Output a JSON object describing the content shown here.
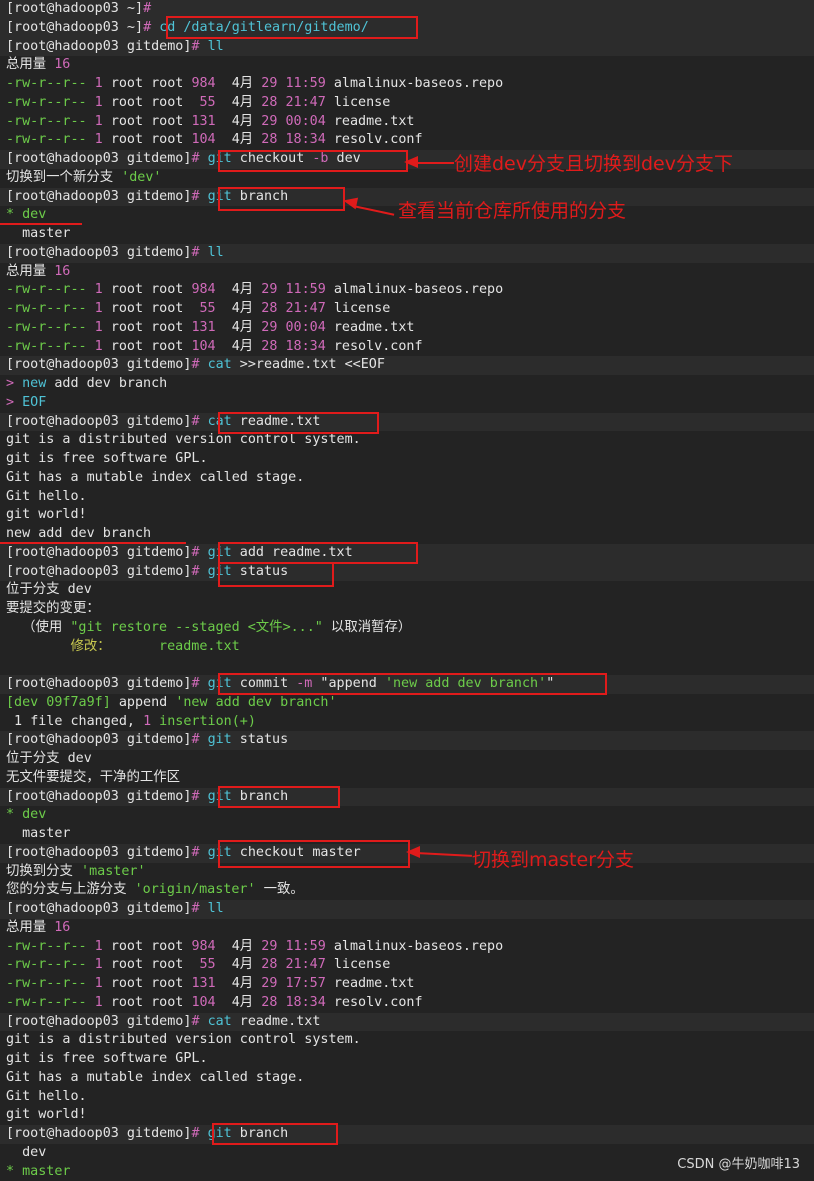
{
  "lines": [
    {
      "pl": 1,
      "segs": [
        [
          "[root@hadoop03 ~]",
          "wt"
        ],
        [
          "#",
          "pr"
        ]
      ]
    },
    {
      "pl": 1,
      "segs": [
        [
          "[root@hadoop03 ~]",
          "wt"
        ],
        [
          "# ",
          "pr"
        ],
        [
          "cd /data/gitlearn/gitdemo/",
          "cy"
        ]
      ]
    },
    {
      "pl": 1,
      "segs": [
        [
          "[root@hadoop03 gitdemo]",
          "wt"
        ],
        [
          "# ",
          "pr"
        ],
        [
          "ll",
          "cy"
        ]
      ]
    },
    {
      "segs": [
        [
          "总用量 ",
          "wt"
        ],
        [
          "16",
          "nm"
        ]
      ]
    },
    {
      "segs": [
        [
          "-rw-r--r--",
          "g"
        ],
        [
          " 1 ",
          "nm"
        ],
        [
          "root root ",
          "wt"
        ],
        [
          "984",
          "nm"
        ],
        [
          "  4月 ",
          "wt"
        ],
        [
          "29 11:59",
          "nm"
        ],
        [
          " almalinux-baseos.repo",
          "wt"
        ]
      ]
    },
    {
      "segs": [
        [
          "-rw-r--r--",
          "g"
        ],
        [
          " 1 ",
          "nm"
        ],
        [
          "root root  ",
          "wt"
        ],
        [
          "55",
          "nm"
        ],
        [
          "  4月 ",
          "wt"
        ],
        [
          "28 21:47",
          "nm"
        ],
        [
          " license",
          "wt"
        ]
      ]
    },
    {
      "segs": [
        [
          "-rw-r--r--",
          "g"
        ],
        [
          " 1 ",
          "nm"
        ],
        [
          "root root ",
          "wt"
        ],
        [
          "131",
          "nm"
        ],
        [
          "  4月 ",
          "wt"
        ],
        [
          "29 00:04",
          "nm"
        ],
        [
          " readme.txt",
          "wt"
        ]
      ]
    },
    {
      "segs": [
        [
          "-rw-r--r--",
          "g"
        ],
        [
          " 1 ",
          "nm"
        ],
        [
          "root root ",
          "wt"
        ],
        [
          "104",
          "nm"
        ],
        [
          "  4月 ",
          "wt"
        ],
        [
          "28 18:34",
          "nm"
        ],
        [
          " resolv.conf",
          "wt"
        ]
      ]
    },
    {
      "pl": 1,
      "segs": [
        [
          "[root@hadoop03 gitdemo]",
          "wt"
        ],
        [
          "# ",
          "pr"
        ],
        [
          "git",
          "cy"
        ],
        [
          " checkout ",
          "wt"
        ],
        [
          "-b",
          "nm"
        ],
        [
          " dev",
          "wt"
        ]
      ]
    },
    {
      "segs": [
        [
          "切换到一个新分支 ",
          "wt"
        ],
        [
          "'dev'",
          "str"
        ]
      ]
    },
    {
      "pl": 1,
      "segs": [
        [
          "[root@hadoop03 gitdemo]",
          "wt"
        ],
        [
          "# ",
          "pr"
        ],
        [
          "git",
          "cy"
        ],
        [
          " branch",
          "wt"
        ]
      ]
    },
    {
      "segs": [
        [
          "* dev",
          "g"
        ]
      ]
    },
    {
      "segs": [
        [
          "  master",
          "wt"
        ]
      ]
    },
    {
      "pl": 1,
      "segs": [
        [
          "[root@hadoop03 gitdemo]",
          "wt"
        ],
        [
          "# ",
          "pr"
        ],
        [
          "ll",
          "cy"
        ]
      ]
    },
    {
      "segs": [
        [
          "总用量 ",
          "wt"
        ],
        [
          "16",
          "nm"
        ]
      ]
    },
    {
      "segs": [
        [
          "-rw-r--r--",
          "g"
        ],
        [
          " 1 ",
          "nm"
        ],
        [
          "root root ",
          "wt"
        ],
        [
          "984",
          "nm"
        ],
        [
          "  4月 ",
          "wt"
        ],
        [
          "29 11:59",
          "nm"
        ],
        [
          " almalinux-baseos.repo",
          "wt"
        ]
      ]
    },
    {
      "segs": [
        [
          "-rw-r--r--",
          "g"
        ],
        [
          " 1 ",
          "nm"
        ],
        [
          "root root  ",
          "wt"
        ],
        [
          "55",
          "nm"
        ],
        [
          "  4月 ",
          "wt"
        ],
        [
          "28 21:47",
          "nm"
        ],
        [
          " license",
          "wt"
        ]
      ]
    },
    {
      "segs": [
        [
          "-rw-r--r--",
          "g"
        ],
        [
          " 1 ",
          "nm"
        ],
        [
          "root root ",
          "wt"
        ],
        [
          "131",
          "nm"
        ],
        [
          "  4月 ",
          "wt"
        ],
        [
          "29 00:04",
          "nm"
        ],
        [
          " readme.txt",
          "wt"
        ]
      ]
    },
    {
      "segs": [
        [
          "-rw-r--r--",
          "g"
        ],
        [
          " 1 ",
          "nm"
        ],
        [
          "root root ",
          "wt"
        ],
        [
          "104",
          "nm"
        ],
        [
          "  4月 ",
          "wt"
        ],
        [
          "28 18:34",
          "nm"
        ],
        [
          " resolv.conf",
          "wt"
        ]
      ]
    },
    {
      "pl": 1,
      "segs": [
        [
          "[root@hadoop03 gitdemo]",
          "wt"
        ],
        [
          "# ",
          "pr"
        ],
        [
          "cat",
          "cy"
        ],
        [
          " >>readme.txt <<EOF",
          "wt"
        ]
      ]
    },
    {
      "segs": [
        [
          "> ",
          "pr"
        ],
        [
          "new",
          "cy"
        ],
        [
          " add dev branch",
          "wt"
        ]
      ]
    },
    {
      "segs": [
        [
          "> ",
          "pr"
        ],
        [
          "EOF",
          "cy"
        ]
      ]
    },
    {
      "pl": 1,
      "segs": [
        [
          "[root@hadoop03 gitdemo]",
          "wt"
        ],
        [
          "# ",
          "pr"
        ],
        [
          "cat",
          "cy"
        ],
        [
          " readme.txt",
          "wt"
        ]
      ]
    },
    {
      "segs": [
        [
          "git is a distributed version control system.",
          "wt"
        ]
      ]
    },
    {
      "segs": [
        [
          "git is free software GPL.",
          "wt"
        ]
      ]
    },
    {
      "segs": [
        [
          "Git has a mutable index called stage.",
          "wt"
        ]
      ]
    },
    {
      "segs": [
        [
          "Git hello.",
          "wt"
        ]
      ]
    },
    {
      "segs": [
        [
          "git world!",
          "wt"
        ]
      ]
    },
    {
      "segs": [
        [
          "new add dev branch",
          "wt"
        ]
      ]
    },
    {
      "pl": 1,
      "segs": [
        [
          "[root@hadoop03 gitdemo]",
          "wt"
        ],
        [
          "# ",
          "pr"
        ],
        [
          "git",
          "cy"
        ],
        [
          " add readme.txt",
          "wt"
        ]
      ]
    },
    {
      "pl": 1,
      "segs": [
        [
          "[root@hadoop03 gitdemo]",
          "wt"
        ],
        [
          "# ",
          "pr"
        ],
        [
          "git",
          "cy"
        ],
        [
          " status",
          "wt"
        ]
      ]
    },
    {
      "segs": [
        [
          "位于分支 dev",
          "wt"
        ]
      ]
    },
    {
      "segs": [
        [
          "要提交的变更：",
          "wt"
        ]
      ]
    },
    {
      "segs": [
        [
          "  （使用 ",
          "wt"
        ],
        [
          "\"git restore --staged <文件>...\"",
          "str"
        ],
        [
          " 以取消暂存）",
          "wt"
        ]
      ]
    },
    {
      "segs": [
        [
          "        修改：      ",
          "dm"
        ],
        [
          "readme.txt",
          "str"
        ]
      ]
    },
    {
      "segs": [
        [
          "",
          "wt"
        ]
      ]
    },
    {
      "pl": 1,
      "segs": [
        [
          "[root@hadoop03 gitdemo]",
          "wt"
        ],
        [
          "# ",
          "pr"
        ],
        [
          "git",
          "cy"
        ],
        [
          " commit ",
          "wt"
        ],
        [
          "-m",
          "nm"
        ],
        [
          " \"append ",
          "wt"
        ],
        [
          "'new add dev branch'",
          "str"
        ],
        [
          "\"",
          "wt"
        ]
      ]
    },
    {
      "segs": [
        [
          "[dev 09f7a9f]",
          "g"
        ],
        [
          " append ",
          "wt"
        ],
        [
          "'new add dev branch'",
          "str"
        ]
      ]
    },
    {
      "segs": [
        [
          " 1 ",
          "wt"
        ],
        [
          "file changed, ",
          "wt"
        ],
        [
          "1",
          "nm"
        ],
        [
          " insertion(+)",
          "g"
        ]
      ]
    },
    {
      "pl": 1,
      "segs": [
        [
          "[root@hadoop03 gitdemo]",
          "wt"
        ],
        [
          "# ",
          "pr"
        ],
        [
          "git",
          "cy"
        ],
        [
          " status",
          "wt"
        ]
      ]
    },
    {
      "segs": [
        [
          "位于分支 dev",
          "wt"
        ]
      ]
    },
    {
      "segs": [
        [
          "无文件要提交，干净的工作区",
          "wt"
        ]
      ]
    },
    {
      "pl": 1,
      "segs": [
        [
          "[root@hadoop03 gitdemo]",
          "wt"
        ],
        [
          "# ",
          "pr"
        ],
        [
          "git",
          "cy"
        ],
        [
          " branch",
          "wt"
        ]
      ]
    },
    {
      "segs": [
        [
          "* dev",
          "g"
        ]
      ]
    },
    {
      "segs": [
        [
          "  master",
          "wt"
        ]
      ]
    },
    {
      "pl": 1,
      "segs": [
        [
          "[root@hadoop03 gitdemo]",
          "wt"
        ],
        [
          "# ",
          "pr"
        ],
        [
          "git",
          "cy"
        ],
        [
          " checkout master",
          "wt"
        ]
      ]
    },
    {
      "segs": [
        [
          "切换到分支 ",
          "wt"
        ],
        [
          "'master'",
          "str"
        ]
      ]
    },
    {
      "segs": [
        [
          "您的分支与上游分支 ",
          "wt"
        ],
        [
          "'origin/master'",
          "str"
        ],
        [
          " 一致。",
          "wt"
        ]
      ]
    },
    {
      "pl": 1,
      "segs": [
        [
          "[root@hadoop03 gitdemo]",
          "wt"
        ],
        [
          "# ",
          "pr"
        ],
        [
          "ll",
          "cy"
        ]
      ]
    },
    {
      "segs": [
        [
          "总用量 ",
          "wt"
        ],
        [
          "16",
          "nm"
        ]
      ]
    },
    {
      "segs": [
        [
          "-rw-r--r--",
          "g"
        ],
        [
          " 1 ",
          "nm"
        ],
        [
          "root root ",
          "wt"
        ],
        [
          "984",
          "nm"
        ],
        [
          "  4月 ",
          "wt"
        ],
        [
          "29 11:59",
          "nm"
        ],
        [
          " almalinux-baseos.repo",
          "wt"
        ]
      ]
    },
    {
      "segs": [
        [
          "-rw-r--r--",
          "g"
        ],
        [
          " 1 ",
          "nm"
        ],
        [
          "root root  ",
          "wt"
        ],
        [
          "55",
          "nm"
        ],
        [
          "  4月 ",
          "wt"
        ],
        [
          "28 21:47",
          "nm"
        ],
        [
          " license",
          "wt"
        ]
      ]
    },
    {
      "segs": [
        [
          "-rw-r--r--",
          "g"
        ],
        [
          " 1 ",
          "nm"
        ],
        [
          "root root ",
          "wt"
        ],
        [
          "131",
          "nm"
        ],
        [
          "  4月 ",
          "wt"
        ],
        [
          "29 17:57",
          "nm"
        ],
        [
          " readme.txt",
          "wt"
        ]
      ]
    },
    {
      "segs": [
        [
          "-rw-r--r--",
          "g"
        ],
        [
          " 1 ",
          "nm"
        ],
        [
          "root root ",
          "wt"
        ],
        [
          "104",
          "nm"
        ],
        [
          "  4月 ",
          "wt"
        ],
        [
          "28 18:34",
          "nm"
        ],
        [
          " resolv.conf",
          "wt"
        ]
      ]
    },
    {
      "pl": 1,
      "segs": [
        [
          "[root@hadoop03 gitdemo]",
          "wt"
        ],
        [
          "# ",
          "pr"
        ],
        [
          "cat",
          "cy"
        ],
        [
          " readme.txt",
          "wt"
        ]
      ]
    },
    {
      "segs": [
        [
          "git is a distributed version control system.",
          "wt"
        ]
      ]
    },
    {
      "segs": [
        [
          "git is free software GPL.",
          "wt"
        ]
      ]
    },
    {
      "segs": [
        [
          "Git has a mutable index called stage.",
          "wt"
        ]
      ]
    },
    {
      "segs": [
        [
          "Git hello.",
          "wt"
        ]
      ]
    },
    {
      "segs": [
        [
          "git world!",
          "wt"
        ]
      ]
    },
    {
      "pl": 1,
      "segs": [
        [
          "[root@hadoop03 gitdemo]",
          "wt"
        ],
        [
          "# ",
          "pr"
        ],
        [
          "git",
          "cy"
        ],
        [
          " branch",
          "wt"
        ]
      ]
    },
    {
      "segs": [
        [
          "  dev",
          "wt"
        ]
      ]
    },
    {
      "segs": [
        [
          "* master",
          "g"
        ]
      ]
    }
  ],
  "annotations": {
    "note_dev": "创建dev分支且切换到dev分支下",
    "note_branch": "查看当前仓库所使用的分支",
    "note_master": "切换到master分支"
  },
  "watermark": "CSDN @牛奶咖啡13",
  "colors": {
    "annotation": "#e01b1b",
    "prompt_hash": "#d06ab9",
    "command": "#4fc3d6",
    "perm": "#6dcc4a"
  }
}
